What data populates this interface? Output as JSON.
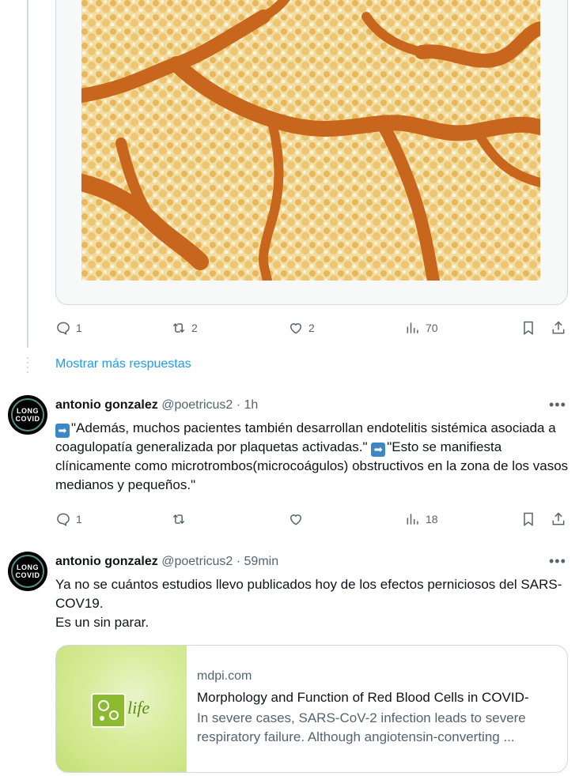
{
  "top_post": {
    "actions": {
      "replies": "1",
      "reposts": "2",
      "likes": "2",
      "views": "70"
    }
  },
  "show_more_replies": "Mostrar más respuestas",
  "tweets": [
    {
      "avatar_top": "LONG",
      "avatar_bottom": "COVID",
      "name": "antonio gonzalez",
      "handle": "@poetricus2",
      "sep": "·",
      "time": "1h",
      "lines": [
        "\"Además, muchos pacientes también desarrollan endotelitis sistémica asociada a coagulopatía generalizada por plaquetas activadas.\"",
        "\"Esto se manifiesta clínicamente como microtrombos(microcoágulos) obstructivos en la zona de los vasos medianos y pequeños.\""
      ],
      "arrow": "➡",
      "actions": {
        "replies": "1",
        "reposts": "",
        "likes": "",
        "views": "18"
      }
    },
    {
      "avatar_top": "LONG",
      "avatar_bottom": "COVID",
      "name": "antonio gonzalez",
      "handle": "@poetricus2",
      "sep": "·",
      "time": "59min",
      "text_1": "Ya no se cuántos estudios llevo publicados hoy de los efectos perniciosos del SARS-COV19.",
      "text_2": "Es un sin parar.",
      "link_card": {
        "thumb_word": "life",
        "domain": "mdpi.com",
        "title": "Morphology and Function of Red Blood Cells in COVID-",
        "description": "In severe cases, SARS-CoV-2 infection leads to severe respiratory failure. Although angiotensin-converting ..."
      }
    }
  ],
  "icons": {
    "more": "more-icon",
    "reply": "reply-icon",
    "repost": "repost-icon",
    "like": "heart-icon",
    "views": "views-icon",
    "bookmark": "bookmark-icon",
    "share": "share-icon"
  },
  "colors": {
    "link": "#1d9bf0",
    "muted": "#536471",
    "text": "#0f1419",
    "border": "#cfd9de"
  }
}
